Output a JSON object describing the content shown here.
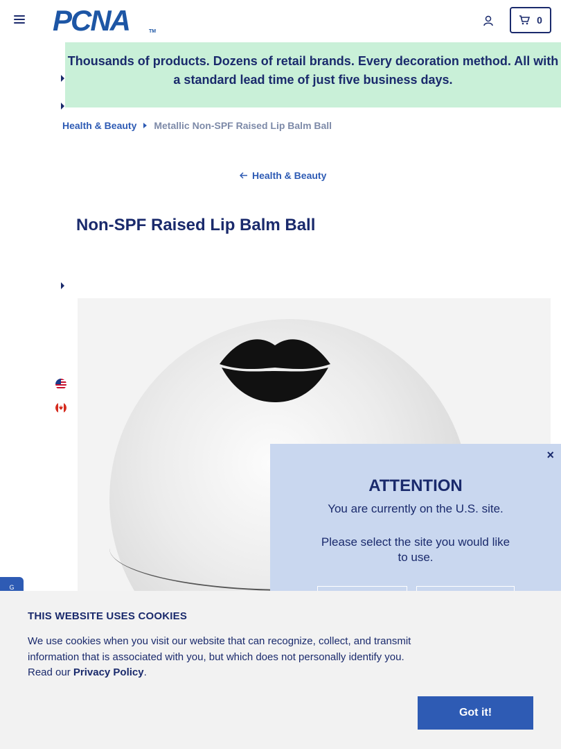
{
  "header": {
    "logo_text": "PCNA",
    "logo_tm": "TM",
    "cart_count": "0"
  },
  "banner": {
    "text": "Thousands of products. Dozens of retail brands. Every decoration method. All with a standard lead time of just five business days."
  },
  "breadcrumb": {
    "parent": "Health & Beauty",
    "current": "Metallic Non-SPF Raised Lip Balm Ball"
  },
  "back_link": "Health & Beauty",
  "product": {
    "title": "Non-SPF Raised Lip Balm Ball"
  },
  "side_tab": "G",
  "attention": {
    "close": "×",
    "title": "ATTENTION",
    "line1": "You are currently on the U.S. site.",
    "line2": "Please select the site you would like to use."
  },
  "cookie": {
    "title": "THIS WEBSITE USES COOKIES",
    "text_before": "We use cookies when you visit our website that can recognize, collect, and transmit information that is associated with you, but which does not personally identify you. Read our ",
    "link": "Privacy Policy",
    "text_after": ".",
    "button": "Got it!"
  },
  "colors": {
    "navy": "#1a2a6c",
    "link_blue": "#2e5bb4",
    "banner_green": "#c9f0d8",
    "modal_blue": "#c9d7ef"
  }
}
